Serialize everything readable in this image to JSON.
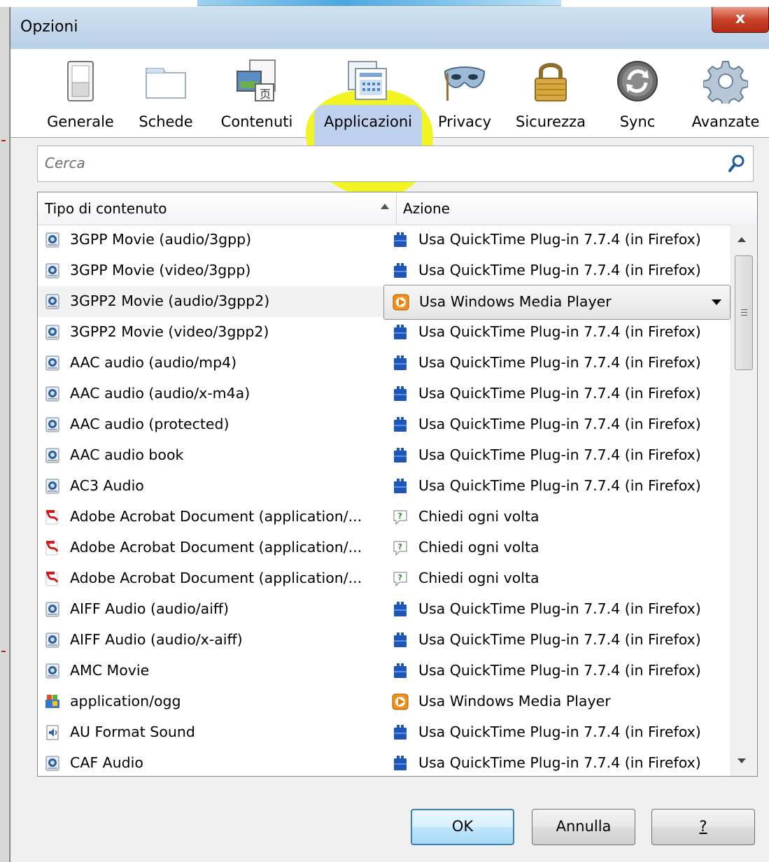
{
  "window": {
    "title": "Opzioni",
    "close_label": "x"
  },
  "toolbar": {
    "items": [
      {
        "label": "Generale",
        "icon": "switch-icon"
      },
      {
        "label": "Schede",
        "icon": "tabs-icon"
      },
      {
        "label": "Contenuti",
        "icon": "content-icon"
      },
      {
        "label": "Applicazioni",
        "icon": "applications-icon",
        "selected": true
      },
      {
        "label": "Privacy",
        "icon": "mask-icon"
      },
      {
        "label": "Sicurezza",
        "icon": "padlock-icon"
      },
      {
        "label": "Sync",
        "icon": "sync-icon"
      },
      {
        "label": "Avanzate",
        "icon": "gear-icon"
      }
    ],
    "highlight_color": "#f0f316"
  },
  "search": {
    "placeholder": "Cerca"
  },
  "table": {
    "columns": [
      "Tipo di contenuto",
      "Azione"
    ],
    "sort_indicator": "ascending",
    "rows": [
      {
        "type": "3GPP Movie (audio/3gpp)",
        "type_icon": "quicktime-icon",
        "action": "Usa QuickTime Plug-in 7.7.4 (in Firefox)",
        "action_icon": "plugin-icon"
      },
      {
        "type": "3GPP Movie (video/3gpp)",
        "type_icon": "quicktime-icon",
        "action": "Usa QuickTime Plug-in 7.7.4 (in Firefox)",
        "action_icon": "plugin-icon"
      },
      {
        "type": "3GPP2 Movie (audio/3gpp2)",
        "type_icon": "quicktime-icon",
        "action": "Usa Windows Media Player",
        "action_icon": "media-player-icon",
        "selected": true
      },
      {
        "type": "3GPP2 Movie (video/3gpp2)",
        "type_icon": "quicktime-icon",
        "action": "Usa QuickTime Plug-in 7.7.4 (in Firefox)",
        "action_icon": "plugin-icon"
      },
      {
        "type": "AAC audio (audio/mp4)",
        "type_icon": "quicktime-icon",
        "action": "Usa QuickTime Plug-in 7.7.4 (in Firefox)",
        "action_icon": "plugin-icon"
      },
      {
        "type": "AAC audio (audio/x-m4a)",
        "type_icon": "quicktime-icon",
        "action": "Usa QuickTime Plug-in 7.7.4 (in Firefox)",
        "action_icon": "plugin-icon"
      },
      {
        "type": "AAC audio (protected)",
        "type_icon": "quicktime-icon",
        "action": "Usa QuickTime Plug-in 7.7.4 (in Firefox)",
        "action_icon": "plugin-icon"
      },
      {
        "type": "AAC audio book",
        "type_icon": "quicktime-icon",
        "action": "Usa QuickTime Plug-in 7.7.4 (in Firefox)",
        "action_icon": "plugin-icon"
      },
      {
        "type": "AC3 Audio",
        "type_icon": "quicktime-icon",
        "action": "Usa QuickTime Plug-in 7.7.4 (in Firefox)",
        "action_icon": "plugin-icon"
      },
      {
        "type": "Adobe Acrobat Document (application/...",
        "type_icon": "pdf-icon",
        "action": "Chiedi ogni volta",
        "action_icon": "ask-icon"
      },
      {
        "type": "Adobe Acrobat Document (application/...",
        "type_icon": "pdf-icon",
        "action": "Chiedi ogni volta",
        "action_icon": "ask-icon"
      },
      {
        "type": "Adobe Acrobat Document (application/...",
        "type_icon": "pdf-icon",
        "action": "Chiedi ogni volta",
        "action_icon": "ask-icon"
      },
      {
        "type": "AIFF Audio (audio/aiff)",
        "type_icon": "quicktime-icon",
        "action": "Usa QuickTime Plug-in 7.7.4 (in Firefox)",
        "action_icon": "plugin-icon"
      },
      {
        "type": "AIFF Audio (audio/x-aiff)",
        "type_icon": "quicktime-icon",
        "action": "Usa QuickTime Plug-in 7.7.4 (in Firefox)",
        "action_icon": "plugin-icon"
      },
      {
        "type": "AMC Movie",
        "type_icon": "quicktime-icon",
        "action": "Usa QuickTime Plug-in 7.7.4 (in Firefox)",
        "action_icon": "plugin-icon"
      },
      {
        "type": "application/ogg",
        "type_icon": "windows-app-icon",
        "action": "Usa Windows Media Player",
        "action_icon": "media-player-icon"
      },
      {
        "type": "AU Format Sound",
        "type_icon": "sound-file-icon",
        "action": "Usa QuickTime Plug-in 7.7.4 (in Firefox)",
        "action_icon": "plugin-icon"
      },
      {
        "type": "CAF Audio",
        "type_icon": "quicktime-icon",
        "action": "Usa QuickTime Plug-in 7.7.4 (in Firefox)",
        "action_icon": "plugin-icon"
      }
    ]
  },
  "buttons": {
    "ok": "OK",
    "cancel": "Annulla",
    "help": "?"
  }
}
